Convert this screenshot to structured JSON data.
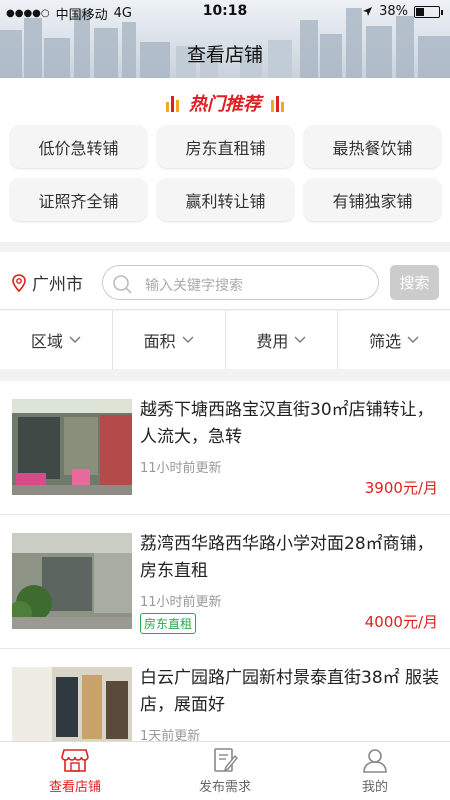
{
  "status_bar": {
    "signal_dots": "●●●●○",
    "carrier": "中国移动",
    "network": "4G",
    "time": "10:18",
    "battery_text": "38%",
    "battery_level": 0.38
  },
  "header": {
    "title": "查看店铺"
  },
  "hot": {
    "title": "热门推荐",
    "chips": [
      "低价急转铺",
      "房东直租铺",
      "最热餐饮铺",
      "证照齐全铺",
      "赢利转让铺",
      "有铺独家铺"
    ]
  },
  "search": {
    "city": "广州市",
    "placeholder": "输入关键字搜索",
    "button_label": "搜索"
  },
  "filters": [
    "区域",
    "面积",
    "费用",
    "筛选"
  ],
  "listings": [
    {
      "title": "越秀下塘西路宝汉直街30㎡店铺转让，人流大，急转",
      "time": "11小时前更新",
      "tag": "",
      "price": "3900元/月"
    },
    {
      "title": "荔湾西华路西华路小学对面28㎡商铺，房东直租",
      "time": "11小时前更新",
      "tag": "房东直租",
      "price": "4000元/月"
    },
    {
      "title": "白云广园路广园新村景泰直街38㎡ 服装店，展面好",
      "time": "1天前更新",
      "tag": "",
      "price": ""
    }
  ],
  "tabbar": {
    "tabs": [
      {
        "label": "查看店铺",
        "icon": "store-icon",
        "active": true
      },
      {
        "label": "发布需求",
        "icon": "edit-icon",
        "active": false
      },
      {
        "label": "我的",
        "icon": "user-icon",
        "active": false
      }
    ]
  },
  "colors": {
    "accent": "#e02020",
    "tag_green": "#2aa84a"
  }
}
